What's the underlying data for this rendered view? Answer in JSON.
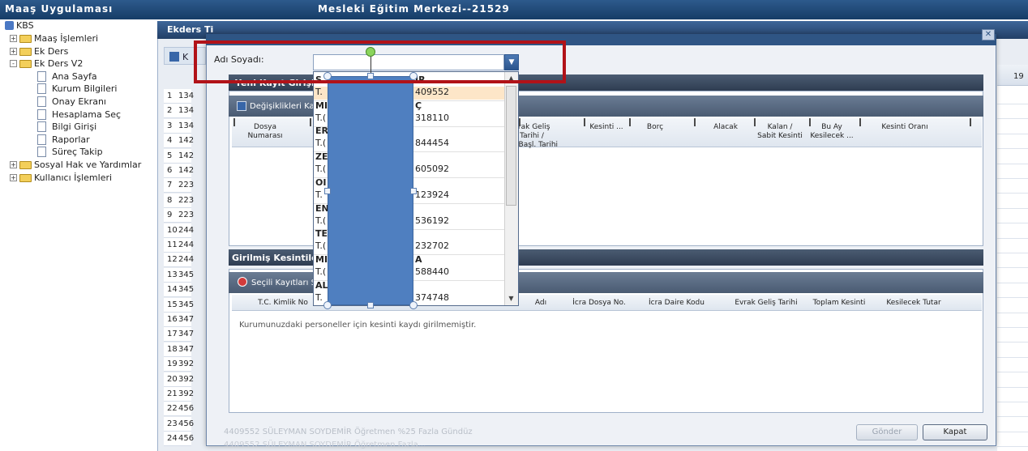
{
  "header": {
    "app_title": "Maaş Uygulaması",
    "center_title": "Mesleki Eğitim Merkezi--21529"
  },
  "tree": {
    "root": "KBS",
    "items": [
      {
        "label": "Maaş İşlemleri",
        "type": "folder",
        "expand": "+"
      },
      {
        "label": "Ek Ders",
        "type": "folder",
        "expand": "+"
      },
      {
        "label": "Ek Ders V2",
        "type": "folder",
        "expand": "-"
      },
      {
        "label": "Ana Sayfa",
        "type": "page"
      },
      {
        "label": "Kurum Bilgileri",
        "type": "page"
      },
      {
        "label": "Onay Ekranı",
        "type": "page"
      },
      {
        "label": "Hesaplama Seç",
        "type": "page"
      },
      {
        "label": "Bilgi Girişi",
        "type": "page"
      },
      {
        "label": "Raporlar",
        "type": "page"
      },
      {
        "label": "Süreç Takip",
        "type": "page"
      },
      {
        "label": "Sosyal Hak ve Yardımlar",
        "type": "folder",
        "expand": "+"
      },
      {
        "label": "Kullanıcı İşlemleri",
        "type": "folder",
        "expand": "+"
      }
    ]
  },
  "background": {
    "title": "Ekders Ti",
    "tool_label": "K",
    "right_col": "19",
    "rows": [
      {
        "n": "1",
        "v": "134"
      },
      {
        "n": "2",
        "v": "134"
      },
      {
        "n": "3",
        "v": "134"
      },
      {
        "n": "4",
        "v": "142"
      },
      {
        "n": "5",
        "v": "142"
      },
      {
        "n": "6",
        "v": "142"
      },
      {
        "n": "7",
        "v": "223"
      },
      {
        "n": "8",
        "v": "223"
      },
      {
        "n": "9",
        "v": "223"
      },
      {
        "n": "10",
        "v": "244"
      },
      {
        "n": "11",
        "v": "244"
      },
      {
        "n": "12",
        "v": "244"
      },
      {
        "n": "13",
        "v": "345"
      },
      {
        "n": "14",
        "v": "345"
      },
      {
        "n": "15",
        "v": "345"
      },
      {
        "n": "16",
        "v": "347"
      },
      {
        "n": "17",
        "v": "347"
      },
      {
        "n": "18",
        "v": "347"
      },
      {
        "n": "19",
        "v": "392"
      },
      {
        "n": "20",
        "v": "392"
      },
      {
        "n": "21",
        "v": "392"
      },
      {
        "n": "22",
        "v": "456"
      },
      {
        "n": "23",
        "v": "456"
      },
      {
        "n": "24",
        "v": "456"
      }
    ],
    "faded_row23": "4409552   SÜLEYMAN   SOYDEMİR   Öğretmen   %25 Fazla Gündüz",
    "faded_row24": "4409552   SÜLEYMAN   SOYDEMİR   Öğretmen   Fazla..."
  },
  "dialog": {
    "name_label": "Adı Soyadı:",
    "section1_title": "Yeni Kayıt Girişi",
    "section1_button": "Değişiklikleri Ka",
    "section1_cols": [
      {
        "l1": "Dosya",
        "l2": "Numarası"
      },
      {
        "l1": "vrak Geliş Tarihi /",
        "l2": "aiz Başl. Tarihi"
      },
      {
        "l1": "Kesinti ...",
        "l2": ""
      },
      {
        "l1": "Borç",
        "l2": ""
      },
      {
        "l1": "Alacak",
        "l2": ""
      },
      {
        "l1": "Kalan /",
        "l2": "Sabit Kesinti"
      },
      {
        "l1": "Bu Ay",
        "l2": "Kesilecek ..."
      },
      {
        "l1": "Kesinti Oranı",
        "l2": ""
      }
    ],
    "section2_title": "Girilmiş Kesintiler",
    "section2_button": "Seçili Kayıtları S",
    "section2_cols": [
      "T.C. Kimlik No",
      "Adı",
      "İcra Dosya No.",
      "İcra Daire Kodu",
      "Evrak Geliş Tarihi",
      "Toplam Kesinti",
      "Kesilecek Tutar"
    ],
    "empty_message": "Kurumunuzdaki personeller için kesinti kaydı girilmemiştir.",
    "send_label": "Gönder",
    "close_label": "Kapat"
  },
  "dropdown": {
    "items": [
      {
        "name": "S",
        "tc": "T.",
        "num": "409552",
        "name_tail": "IR"
      },
      {
        "name": "MI",
        "tc": "T.(",
        "num": "318110",
        "name_tail": "Ç"
      },
      {
        "name": "ER",
        "tc": "T.(",
        "num": "844454",
        "name_tail": ""
      },
      {
        "name": "ZE",
        "tc": "T.(",
        "num": "605092",
        "name_tail": ""
      },
      {
        "name": "OI",
        "tc": "T.",
        "num": "123924",
        "name_tail": ""
      },
      {
        "name": "EN",
        "tc": "T.(",
        "num": "536192",
        "name_tail": ""
      },
      {
        "name": "TE",
        "tc": "T.(",
        "num": "232702",
        "name_tail": ""
      },
      {
        "name": "MI",
        "tc": "T.(",
        "num": "588440",
        "name_tail": "A"
      },
      {
        "name": "AL",
        "tc": "T.",
        "num": "374748",
        "name_tail": ""
      }
    ]
  },
  "colors": {
    "header": "#1f4a7a",
    "highlight": "#b11218",
    "shape": "#4f7fc0"
  }
}
